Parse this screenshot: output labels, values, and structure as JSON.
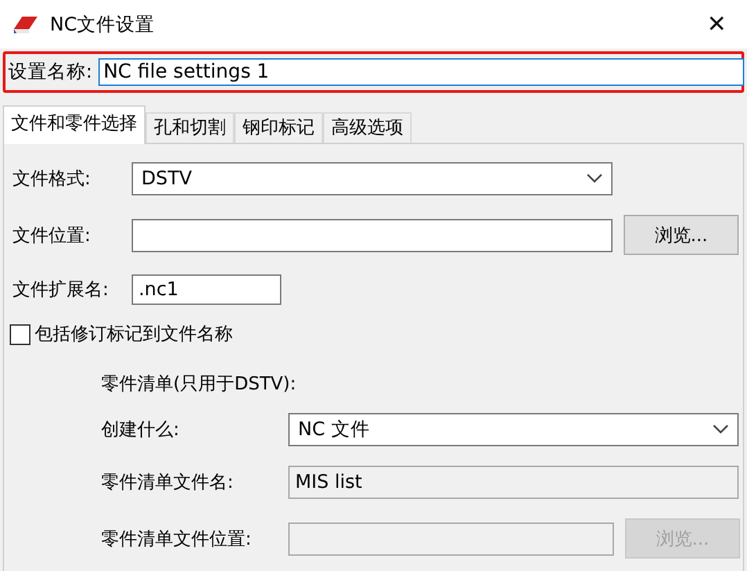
{
  "window": {
    "title": "NC文件设置",
    "close": "✕"
  },
  "setting_name": {
    "label": "设置名称:",
    "value": "NC file settings 1"
  },
  "tabs": [
    {
      "label": "文件和零件选择",
      "selected": true
    },
    {
      "label": "孔和切割",
      "selected": false
    },
    {
      "label": "钢印标记",
      "selected": false
    },
    {
      "label": "高级选项",
      "selected": false
    }
  ],
  "file_format": {
    "label": "文件格式:",
    "value": "DSTV"
  },
  "file_location": {
    "label": "文件位置:",
    "button": {
      "label": "浏览...",
      "disabled": false
    }
  },
  "file_extension": {
    "label": "文件扩展名:",
    "value": ".nc1"
  },
  "include_revision": {
    "label": "包括修订标记到文件名称",
    "checked": false
  },
  "parts_list": {
    "heading": "零件清单(只用于DSTV):",
    "create_what": {
      "label": "创建什么:",
      "value": "NC 文件"
    },
    "file_name": {
      "label": "零件清单文件名:",
      "value": "MIS list",
      "readonly": true
    },
    "file_location": {
      "label": "零件清单文件位置:",
      "disabled": true,
      "button": {
        "label": "浏览...",
        "disabled": true
      }
    }
  }
}
